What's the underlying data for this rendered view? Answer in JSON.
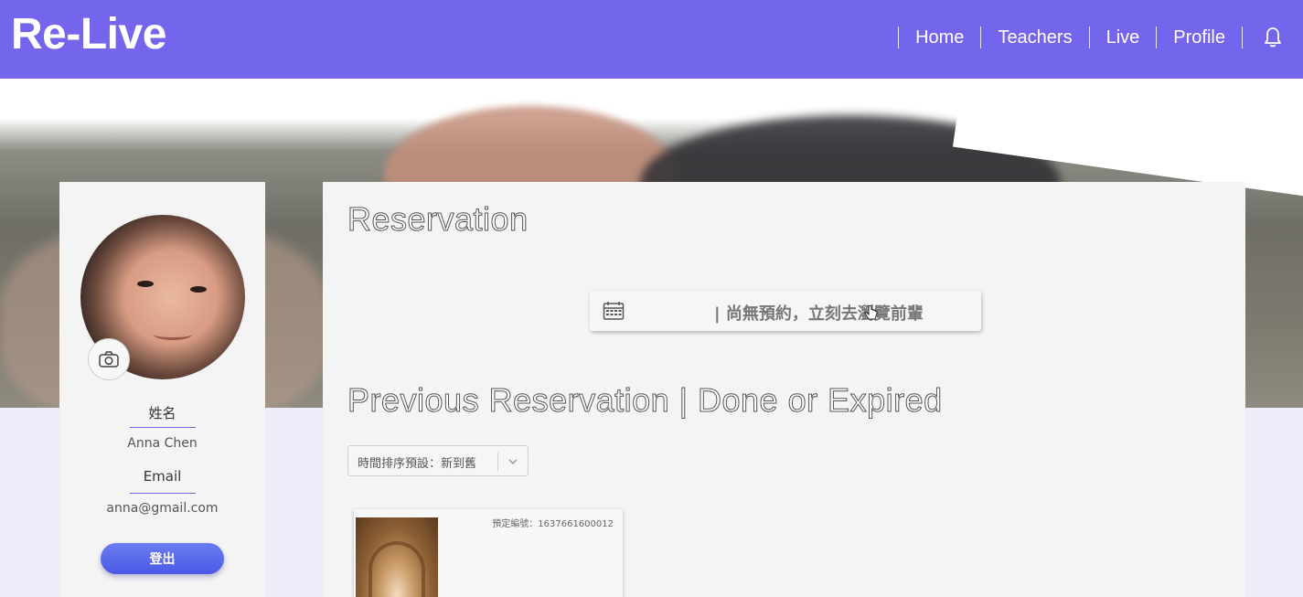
{
  "header": {
    "logo": "Re-Live",
    "nav": [
      "Home",
      "Teachers",
      "Live",
      "Profile"
    ],
    "notification_icon": "bell-icon"
  },
  "profile": {
    "name_label": "姓名",
    "name": "Anna Chen",
    "email_label": "Email",
    "email": "anna@gmail.com",
    "logout_label": "登出",
    "camera_icon": "camera-icon"
  },
  "reservation": {
    "title": "Reservation",
    "empty_message": "| 尚無預約，立刻去瀏覽前輩",
    "empty_icon": "calendar-icon"
  },
  "previous": {
    "title": "Previous Reservation | Done or Expired",
    "sort_selected": "時間排序預設：新到舊",
    "card": {
      "reservation_no": "預定編號：1637661600012"
    }
  },
  "colors": {
    "brand": "#7366ec",
    "logout_button": "#5361e8"
  }
}
